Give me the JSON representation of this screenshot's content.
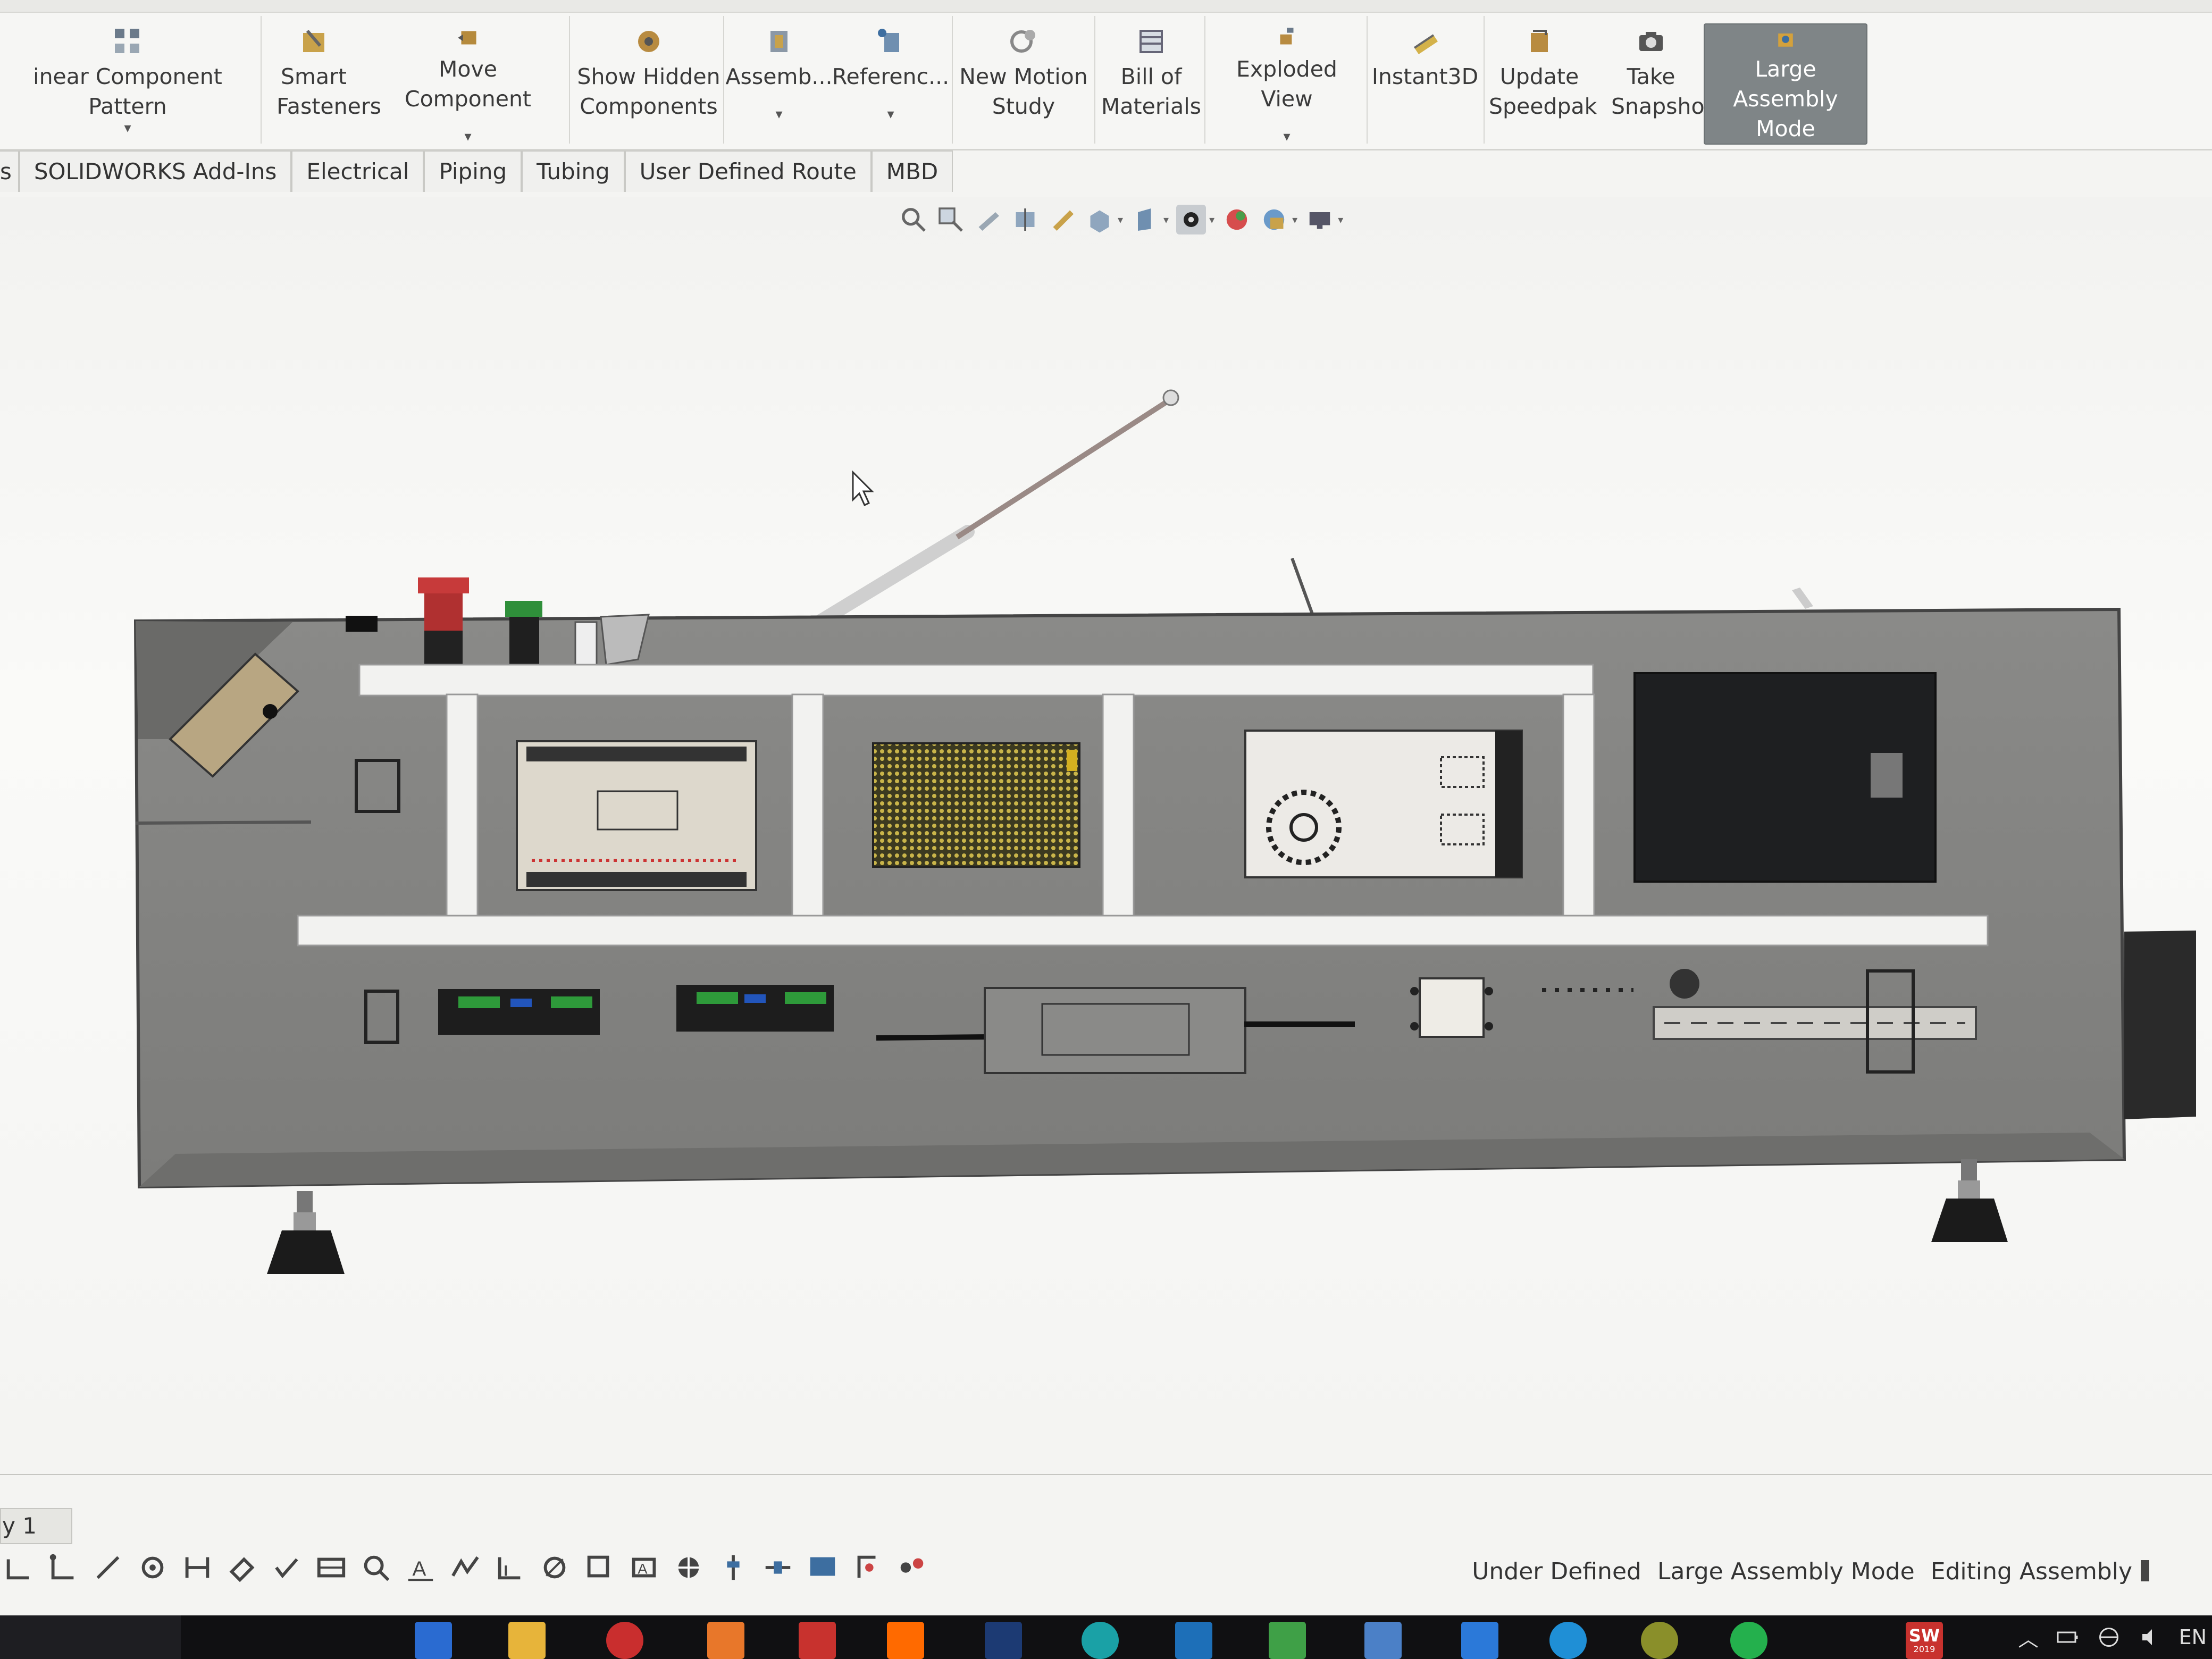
{
  "ribbon": {
    "buttons": [
      {
        "label": "inear Component Pattern",
        "icon": "linear-pattern-icon",
        "dropdown": true
      },
      {
        "label": "Smart Fasteners",
        "icon": "smart-fasteners-icon"
      },
      {
        "label": "Move Component",
        "icon": "move-component-icon",
        "dropdown": true
      },
      {
        "label": "Show Hidden Components",
        "icon": "show-hidden-icon"
      },
      {
        "label": "Assemb...",
        "icon": "assembly-features-icon",
        "dropdown": true
      },
      {
        "label": "Referenc...",
        "icon": "reference-geometry-icon",
        "dropdown": true
      },
      {
        "label": "New Motion Study",
        "icon": "motion-study-icon"
      },
      {
        "label": "Bill of Materials",
        "icon": "bill-of-materials-icon"
      },
      {
        "label": "Exploded View",
        "icon": "exploded-view-icon",
        "dropdown": true
      },
      {
        "label": "Instant3D",
        "icon": "instant3d-icon"
      },
      {
        "label": "Update Speedpak",
        "icon": "speedpak-icon"
      },
      {
        "label": "Take Snapshot",
        "icon": "camera-icon"
      },
      {
        "label": "Large Assembly Mode",
        "icon": "large-assembly-icon",
        "active": true
      }
    ]
  },
  "tabs": [
    "s",
    "SOLIDWORKS Add-Ins",
    "Electrical",
    "Piping",
    "Tubing",
    "User Defined Route",
    "MBD"
  ],
  "sheet_tab": "y 1",
  "status": {
    "definition": "Under Defined",
    "mode": "Large Assembly Mode",
    "editing": "Editing Assembly"
  },
  "taskbar": {
    "solidworks_badge": "SW",
    "solidworks_year": "2019",
    "language": "EN"
  },
  "colors": {
    "panel": "#8f8f8d",
    "rail": "#f2f2f0",
    "ribbon_active": "#7f8587",
    "taskbar": "#101012"
  }
}
